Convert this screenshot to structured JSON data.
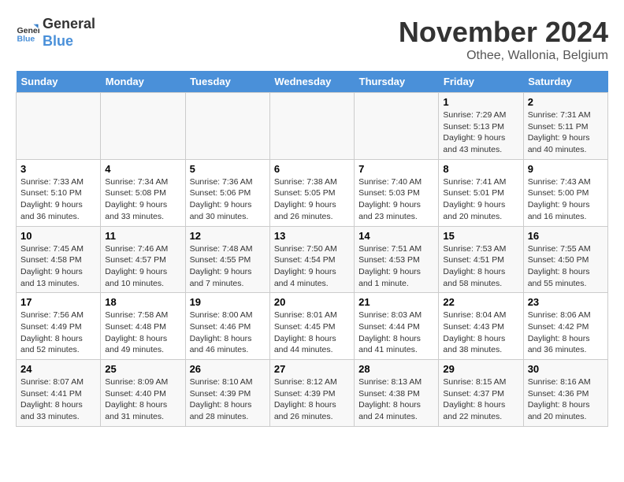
{
  "header": {
    "logo_general": "General",
    "logo_blue": "Blue",
    "month_title": "November 2024",
    "location": "Othee, Wallonia, Belgium"
  },
  "weekdays": [
    "Sunday",
    "Monday",
    "Tuesday",
    "Wednesday",
    "Thursday",
    "Friday",
    "Saturday"
  ],
  "weeks": [
    [
      {
        "day": "",
        "sunrise": "",
        "sunset": "",
        "daylight": ""
      },
      {
        "day": "",
        "sunrise": "",
        "sunset": "",
        "daylight": ""
      },
      {
        "day": "",
        "sunrise": "",
        "sunset": "",
        "daylight": ""
      },
      {
        "day": "",
        "sunrise": "",
        "sunset": "",
        "daylight": ""
      },
      {
        "day": "",
        "sunrise": "",
        "sunset": "",
        "daylight": ""
      },
      {
        "day": "1",
        "sunrise": "Sunrise: 7:29 AM",
        "sunset": "Sunset: 5:13 PM",
        "daylight": "Daylight: 9 hours and 43 minutes."
      },
      {
        "day": "2",
        "sunrise": "Sunrise: 7:31 AM",
        "sunset": "Sunset: 5:11 PM",
        "daylight": "Daylight: 9 hours and 40 minutes."
      }
    ],
    [
      {
        "day": "3",
        "sunrise": "Sunrise: 7:33 AM",
        "sunset": "Sunset: 5:10 PM",
        "daylight": "Daylight: 9 hours and 36 minutes."
      },
      {
        "day": "4",
        "sunrise": "Sunrise: 7:34 AM",
        "sunset": "Sunset: 5:08 PM",
        "daylight": "Daylight: 9 hours and 33 minutes."
      },
      {
        "day": "5",
        "sunrise": "Sunrise: 7:36 AM",
        "sunset": "Sunset: 5:06 PM",
        "daylight": "Daylight: 9 hours and 30 minutes."
      },
      {
        "day": "6",
        "sunrise": "Sunrise: 7:38 AM",
        "sunset": "Sunset: 5:05 PM",
        "daylight": "Daylight: 9 hours and 26 minutes."
      },
      {
        "day": "7",
        "sunrise": "Sunrise: 7:40 AM",
        "sunset": "Sunset: 5:03 PM",
        "daylight": "Daylight: 9 hours and 23 minutes."
      },
      {
        "day": "8",
        "sunrise": "Sunrise: 7:41 AM",
        "sunset": "Sunset: 5:01 PM",
        "daylight": "Daylight: 9 hours and 20 minutes."
      },
      {
        "day": "9",
        "sunrise": "Sunrise: 7:43 AM",
        "sunset": "Sunset: 5:00 PM",
        "daylight": "Daylight: 9 hours and 16 minutes."
      }
    ],
    [
      {
        "day": "10",
        "sunrise": "Sunrise: 7:45 AM",
        "sunset": "Sunset: 4:58 PM",
        "daylight": "Daylight: 9 hours and 13 minutes."
      },
      {
        "day": "11",
        "sunrise": "Sunrise: 7:46 AM",
        "sunset": "Sunset: 4:57 PM",
        "daylight": "Daylight: 9 hours and 10 minutes."
      },
      {
        "day": "12",
        "sunrise": "Sunrise: 7:48 AM",
        "sunset": "Sunset: 4:55 PM",
        "daylight": "Daylight: 9 hours and 7 minutes."
      },
      {
        "day": "13",
        "sunrise": "Sunrise: 7:50 AM",
        "sunset": "Sunset: 4:54 PM",
        "daylight": "Daylight: 9 hours and 4 minutes."
      },
      {
        "day": "14",
        "sunrise": "Sunrise: 7:51 AM",
        "sunset": "Sunset: 4:53 PM",
        "daylight": "Daylight: 9 hours and 1 minute."
      },
      {
        "day": "15",
        "sunrise": "Sunrise: 7:53 AM",
        "sunset": "Sunset: 4:51 PM",
        "daylight": "Daylight: 8 hours and 58 minutes."
      },
      {
        "day": "16",
        "sunrise": "Sunrise: 7:55 AM",
        "sunset": "Sunset: 4:50 PM",
        "daylight": "Daylight: 8 hours and 55 minutes."
      }
    ],
    [
      {
        "day": "17",
        "sunrise": "Sunrise: 7:56 AM",
        "sunset": "Sunset: 4:49 PM",
        "daylight": "Daylight: 8 hours and 52 minutes."
      },
      {
        "day": "18",
        "sunrise": "Sunrise: 7:58 AM",
        "sunset": "Sunset: 4:48 PM",
        "daylight": "Daylight: 8 hours and 49 minutes."
      },
      {
        "day": "19",
        "sunrise": "Sunrise: 8:00 AM",
        "sunset": "Sunset: 4:46 PM",
        "daylight": "Daylight: 8 hours and 46 minutes."
      },
      {
        "day": "20",
        "sunrise": "Sunrise: 8:01 AM",
        "sunset": "Sunset: 4:45 PM",
        "daylight": "Daylight: 8 hours and 44 minutes."
      },
      {
        "day": "21",
        "sunrise": "Sunrise: 8:03 AM",
        "sunset": "Sunset: 4:44 PM",
        "daylight": "Daylight: 8 hours and 41 minutes."
      },
      {
        "day": "22",
        "sunrise": "Sunrise: 8:04 AM",
        "sunset": "Sunset: 4:43 PM",
        "daylight": "Daylight: 8 hours and 38 minutes."
      },
      {
        "day": "23",
        "sunrise": "Sunrise: 8:06 AM",
        "sunset": "Sunset: 4:42 PM",
        "daylight": "Daylight: 8 hours and 36 minutes."
      }
    ],
    [
      {
        "day": "24",
        "sunrise": "Sunrise: 8:07 AM",
        "sunset": "Sunset: 4:41 PM",
        "daylight": "Daylight: 8 hours and 33 minutes."
      },
      {
        "day": "25",
        "sunrise": "Sunrise: 8:09 AM",
        "sunset": "Sunset: 4:40 PM",
        "daylight": "Daylight: 8 hours and 31 minutes."
      },
      {
        "day": "26",
        "sunrise": "Sunrise: 8:10 AM",
        "sunset": "Sunset: 4:39 PM",
        "daylight": "Daylight: 8 hours and 28 minutes."
      },
      {
        "day": "27",
        "sunrise": "Sunrise: 8:12 AM",
        "sunset": "Sunset: 4:39 PM",
        "daylight": "Daylight: 8 hours and 26 minutes."
      },
      {
        "day": "28",
        "sunrise": "Sunrise: 8:13 AM",
        "sunset": "Sunset: 4:38 PM",
        "daylight": "Daylight: 8 hours and 24 minutes."
      },
      {
        "day": "29",
        "sunrise": "Sunrise: 8:15 AM",
        "sunset": "Sunset: 4:37 PM",
        "daylight": "Daylight: 8 hours and 22 minutes."
      },
      {
        "day": "30",
        "sunrise": "Sunrise: 8:16 AM",
        "sunset": "Sunset: 4:36 PM",
        "daylight": "Daylight: 8 hours and 20 minutes."
      }
    ]
  ]
}
